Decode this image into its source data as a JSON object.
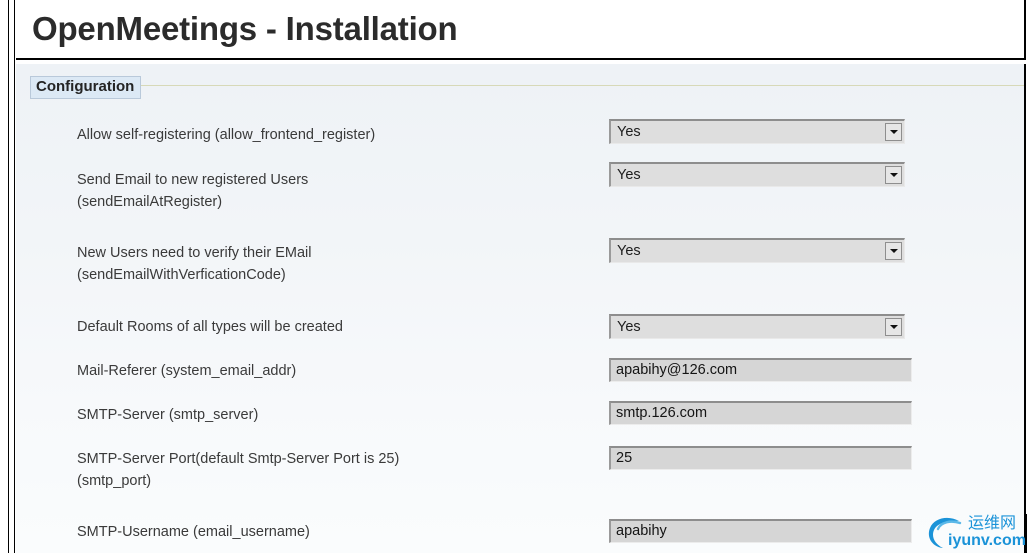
{
  "header": {
    "title": "OpenMeetings - Installation"
  },
  "fieldset": {
    "legend": "Configuration"
  },
  "form": {
    "rows": [
      {
        "label": "Allow self-registering (allow_frontend_register)",
        "control": "select",
        "value": "Yes",
        "name": "allow-frontend-register"
      },
      {
        "label": "Send Email to new registered Users\n(sendEmailAtRegister)",
        "control": "select",
        "value": "Yes",
        "name": "send-email-at-register"
      },
      {
        "label": "New Users need to verify their EMail\n(sendEmailWithVerficationCode)",
        "control": "select",
        "value": "Yes",
        "name": "send-email-with-verfication-code"
      },
      {
        "label": "Default Rooms of all types will be created",
        "control": "select",
        "value": "Yes",
        "name": "default-rooms-created"
      },
      {
        "label": "Mail-Referer (system_email_addr)",
        "control": "text",
        "value": "apabihy@126.com",
        "name": "system-email-addr"
      },
      {
        "label": "SMTP-Server (smtp_server)",
        "control": "text",
        "value": "smtp.126.com",
        "name": "smtp-server"
      },
      {
        "label": "SMTP-Server Port(default Smtp-Server Port is 25)\n(smtp_port)",
        "control": "text",
        "value": "25",
        "name": "smtp-port"
      },
      {
        "label": "SMTP-Username (email_username)",
        "control": "text",
        "value": "apabihy",
        "name": "email-username"
      }
    ]
  },
  "watermark": {
    "cn_text": "运维网",
    "url_text": "iyunv.com",
    "color": "#1b93d8"
  },
  "colors": {
    "legend_bg": "#dce9f5",
    "fieldset_rule": "#d7d9b8",
    "control_fill": "#d6d6d6",
    "page_bg": "#f2f5f8",
    "title_text": "#2b2b2b"
  }
}
